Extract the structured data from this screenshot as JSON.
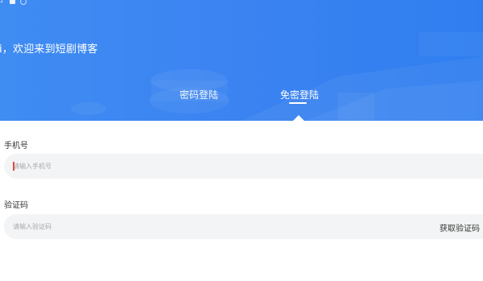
{
  "header": {
    "greeting": "i，欢迎来到短剧博客",
    "status_icons": [
      "app-icon",
      "square-icon",
      "circle-icon"
    ]
  },
  "tabs": [
    {
      "label": "密码登陆",
      "active": false
    },
    {
      "label": "免密登陆",
      "active": true
    }
  ],
  "form": {
    "phone": {
      "label": "手机号",
      "placeholder": "请输入手机号",
      "value": ""
    },
    "code": {
      "label": "验证码",
      "placeholder": "请输入验证码",
      "value": ""
    },
    "get_code_label": "获取验证码"
  },
  "colors": {
    "hero": "#3b83f1",
    "field_bg": "#f3f4f5",
    "cursor": "#e0463f"
  }
}
